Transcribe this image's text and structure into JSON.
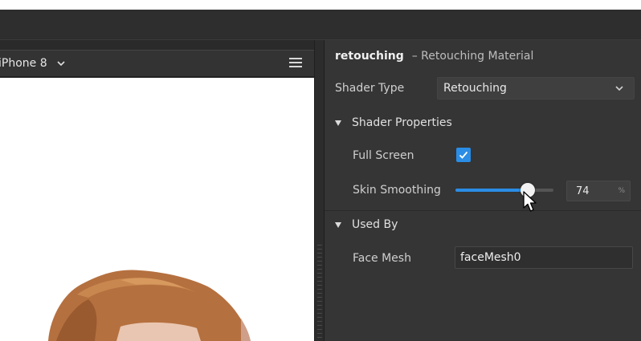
{
  "device": {
    "name": "iPhone 8"
  },
  "inspector": {
    "material_name": "retouching",
    "material_type": "– Retouching Material",
    "shader_type_label": "Shader Type",
    "shader_type_value": "Retouching",
    "sections": {
      "shader_properties": "Shader Properties",
      "used_by": "Used By"
    },
    "full_screen": {
      "label": "Full Screen",
      "checked": true
    },
    "skin_smoothing": {
      "label": "Skin Smoothing",
      "value": "74",
      "unit": "%",
      "percent": 74
    },
    "face_mesh": {
      "label": "Face Mesh",
      "value": "faceMesh0"
    }
  },
  "colors": {
    "accent": "#2a8de6",
    "panel": "#353535",
    "titlebar": "#2e2e2e"
  },
  "icons": [
    "chevron-down-icon",
    "hamburger-menu-icon",
    "checkmark-icon",
    "triangle-down-icon",
    "mouse-pointer-icon"
  ]
}
